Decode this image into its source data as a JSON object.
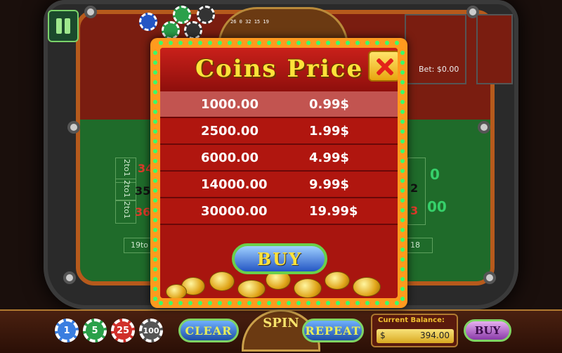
{
  "game": {
    "bet_label": "Bet: $0.00",
    "wheel_numbers": "26 0 32 15 19"
  },
  "table_labels": {
    "column_bets": [
      "2to1",
      "2to1",
      "2to1"
    ],
    "visible_numbers_left": [
      "34",
      "35",
      "36"
    ],
    "dozen_label": "19to",
    "visible_numbers_right": [
      "2",
      "3"
    ],
    "zero_labels": [
      "0",
      "00"
    ],
    "right_cell": "18"
  },
  "modal": {
    "title": "Coins Price",
    "rows": [
      {
        "coins": "1000.00",
        "price": "0.99$",
        "selected": true
      },
      {
        "coins": "2500.00",
        "price": "1.99$",
        "selected": false
      },
      {
        "coins": "6000.00",
        "price": "4.99$",
        "selected": false
      },
      {
        "coins": "14000.00",
        "price": "9.99$",
        "selected": false
      },
      {
        "coins": "30000.00",
        "price": "19.99$",
        "selected": false
      }
    ],
    "buy_label": "BUY"
  },
  "bottom_bar": {
    "chips": [
      {
        "value": "1",
        "color": "#3a7ee0"
      },
      {
        "value": "5",
        "color": "#2aa04a"
      },
      {
        "value": "25",
        "color": "#d0302a"
      },
      {
        "value": "100",
        "color": "#555555"
      }
    ],
    "clear_label": "CLEAR",
    "spin_label": "SPIN",
    "repeat_label": "REPEAT",
    "balance_label": "Current Balance:",
    "balance_currency": "$",
    "balance_value": "394.00",
    "buy_label": "BUY"
  },
  "colors": {
    "modal_frame": "#ff9a1e",
    "modal_body": "#a8150f",
    "title_text": "#ffe23a",
    "button_border": "#6ad04a"
  }
}
